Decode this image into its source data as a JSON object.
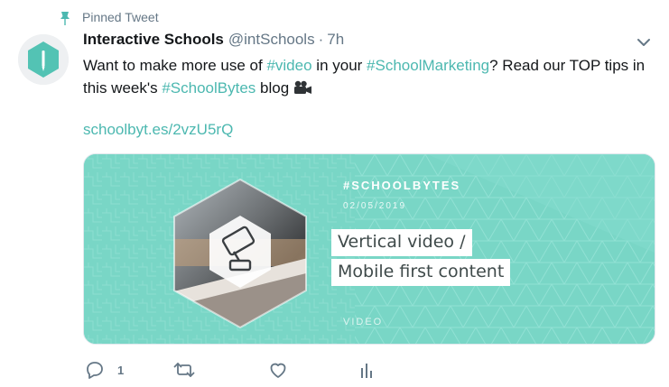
{
  "pinned": {
    "label": "Pinned Tweet",
    "icon": "pin-icon"
  },
  "author": {
    "name": "Interactive Schools",
    "handle": "@intSchools",
    "separator": "·",
    "time": "7h",
    "avatar_icon": "interactive-schools-logo"
  },
  "tweet": {
    "t1": "Want to make more use of ",
    "h1": "#video",
    "t2": " in your ",
    "h2": "#SchoolMarketing",
    "t3": "? Read our TOP tips in this week's ",
    "h3": "#SchoolBytes",
    "t4": " blog",
    "emoji_icon": "movie-camera-icon",
    "url": "schoolbyt.es/2vzU5rQ"
  },
  "card": {
    "tag": "#SCHOOLBYTES",
    "date": "02/05/2019",
    "title_line1": "Vertical video /",
    "title_line2": "Mobile first content",
    "category": "VIDEO",
    "background": "#7dd8c8"
  },
  "actions": {
    "reply_count": "1",
    "icons": [
      "reply-icon",
      "retweet-icon",
      "like-icon",
      "analytics-icon"
    ]
  },
  "colors": {
    "link": "#4cb8b0",
    "secondary_text": "#657786",
    "primary_text": "#14171a"
  }
}
